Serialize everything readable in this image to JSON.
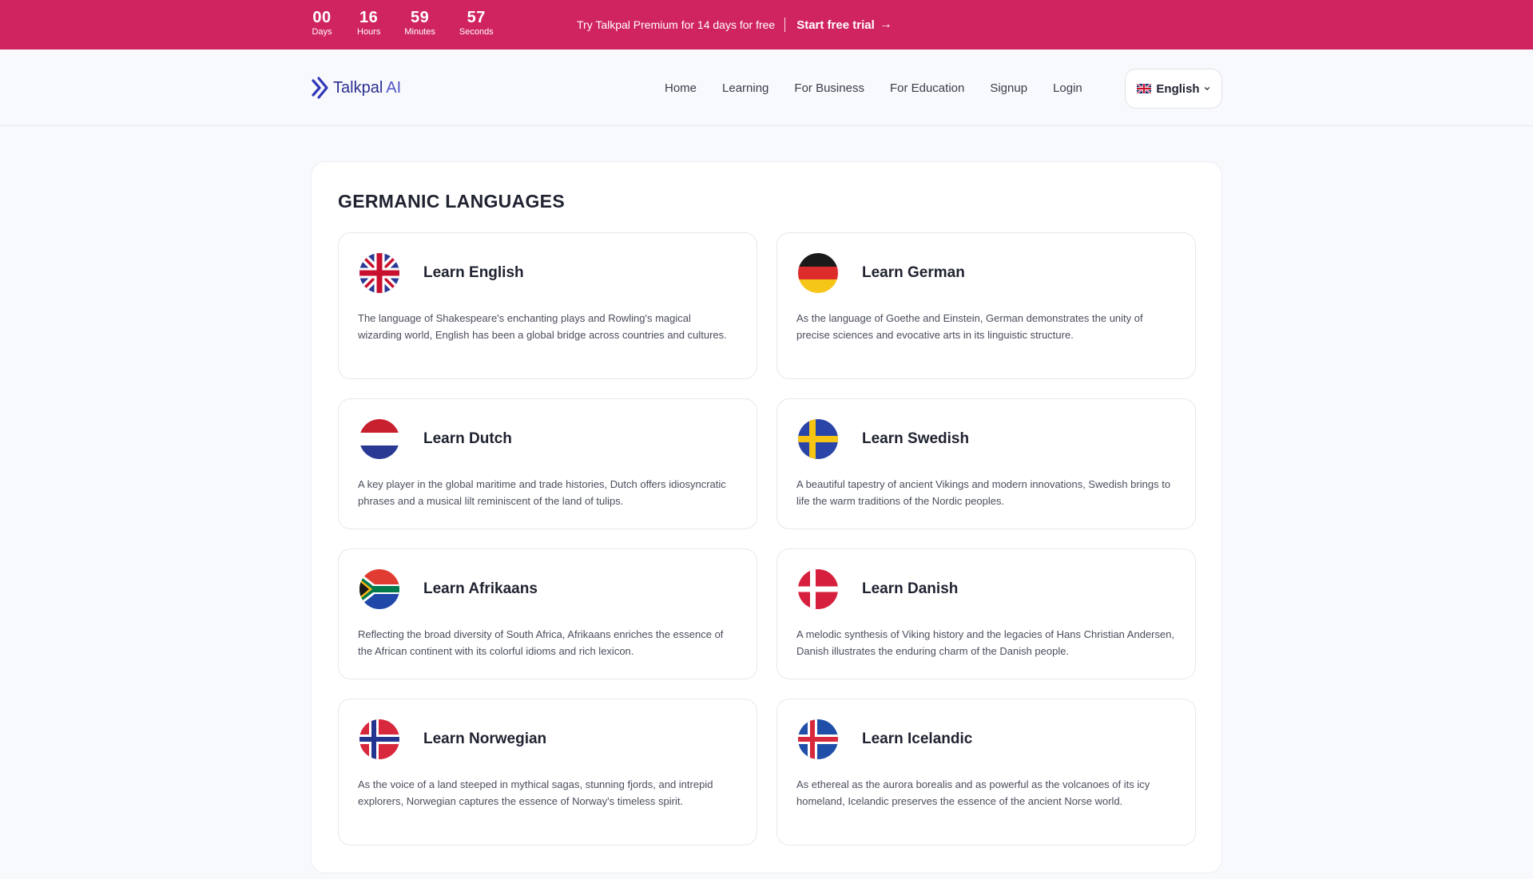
{
  "promo": {
    "countdown": [
      {
        "value": "00",
        "label": "Days"
      },
      {
        "value": "16",
        "label": "Hours"
      },
      {
        "value": "59",
        "label": "Minutes"
      },
      {
        "value": "57",
        "label": "Seconds"
      }
    ],
    "message": "Try Talkpal Premium for 14 days for free",
    "cta_label": "Start free trial",
    "cta_icon": "arrow-right-icon",
    "background_color": "#d02460"
  },
  "header": {
    "logo_name": "Talkpal",
    "logo_suffix": "AI",
    "nav": [
      "Home",
      "Learning",
      "For Business",
      "For Education",
      "Signup",
      "Login"
    ],
    "language": {
      "selected": "English",
      "flag_icon": "uk-flag-icon",
      "chevron_icon": "chevron-down-icon"
    }
  },
  "main": {
    "section_title": "GERMANIC LANGUAGES",
    "cards": [
      {
        "title": "Learn English",
        "flag": "uk-flag-icon",
        "description": "The language of Shakespeare's enchanting plays and Rowling's magical wizarding world, English has been a global bridge across countries and cultures."
      },
      {
        "title": "Learn German",
        "flag": "germany-flag-icon",
        "description": "As the language of Goethe and Einstein, German demonstrates the unity of precise sciences and evocative arts in its linguistic structure."
      },
      {
        "title": "Learn Dutch",
        "flag": "netherlands-flag-icon",
        "description": "A key player in the global maritime and trade histories, Dutch offers idiosyncratic phrases and a musical lilt reminiscent of the land of tulips."
      },
      {
        "title": "Learn Swedish",
        "flag": "sweden-flag-icon",
        "description": "A beautiful tapestry of ancient Vikings and modern innovations, Swedish brings to life the warm traditions of the Nordic peoples."
      },
      {
        "title": "Learn Afrikaans",
        "flag": "south-africa-flag-icon",
        "description": "Reflecting the broad diversity of South Africa, Afrikaans enriches the essence of the African continent with its colorful idioms and rich lexicon."
      },
      {
        "title": "Learn Danish",
        "flag": "denmark-flag-icon",
        "description": "A melodic synthesis of Viking history and the legacies of Hans Christian Andersen, Danish illustrates the enduring charm of the Danish people."
      },
      {
        "title": "Learn Norwegian",
        "flag": "norway-flag-icon",
        "description": "As the voice of a land steeped in mythical sagas, stunning fjords, and intrepid explorers, Norwegian captures the essence of Norway's timeless spirit."
      },
      {
        "title": "Learn Icelandic",
        "flag": "iceland-flag-icon",
        "description": "As ethereal as the aurora borealis and as powerful as the volcanoes of its icy homeland, Icelandic preserves the essence of the ancient Norse world."
      }
    ]
  }
}
